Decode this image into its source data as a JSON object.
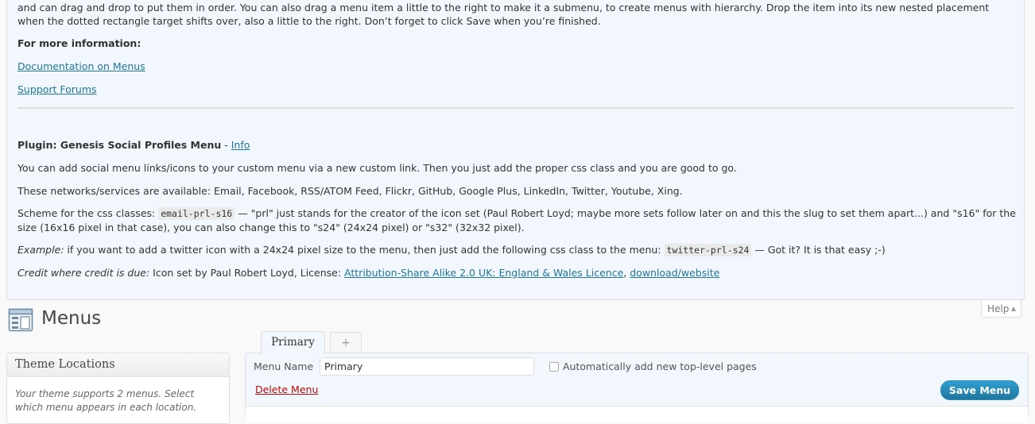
{
  "help": {
    "intro_text": "and can drag and drop to put them in order. You can also drag a menu item a little to the right to make it a submenu, to create menus with hierarchy. Drop the item into its new nested placement when the dotted rectangle target shifts over, also a little to the right. Don’t forget to click Save when you’re finished.",
    "more_info_title": "For more information:",
    "documentation_link": "Documentation on Menus",
    "support_link": "Support Forums",
    "plugin_title": "Plugin: Genesis Social Profiles Menu",
    "plugin_separator": " - ",
    "plugin_info_link": "Info",
    "add_text": "You can add social menu links/icons to your custom menu via a new custom link. Then you just add the proper css class and you are good to go.",
    "networks_text": "These networks/services are available: Email, Facebook, RSS/ATOM Feed, Flickr, GitHub, Google Plus, LinkedIn, Twitter, Youtube, Xing.",
    "scheme_prefix": "Scheme for the css classes: ",
    "scheme_code": "email-prl-s16",
    "scheme_text": " — \"prl\" just stands for the creator of the icon set (Paul Robert Loyd; maybe more sets follow later on and this the slug to set them apart...) and \"s16\" for the size (16x16 pixel in that case), you can also change this to \"s24\" (24x24 pixel) or \"s32\" (32x32 pixel).",
    "example_label": "Example:",
    "example_text": " if you want to add a twitter icon with a 24x24 pixel size to the menu, then just add the following css class to the menu: ",
    "example_code": "twitter-prl-s24",
    "example_suffix": " — Got it? It is that easy ;-)",
    "credit_label": "Credit where credit is due:",
    "credit_text": " Icon set by Paul Robert Loyd, License: ",
    "license_link": "Attribution-Share Alike 2.0 UK: England & Wales Licence",
    "credit_comma": ", ",
    "download_link": "download/website"
  },
  "help_tab": {
    "label": "Help",
    "arrow": "▲"
  },
  "page": {
    "title": "Menus",
    "icon": "menus-icon"
  },
  "theme_locations": {
    "title": "Theme Locations",
    "description": "Your theme supports 2 menus. Select which menu appears in each location."
  },
  "menu_tabs": {
    "active_label": "Primary",
    "add_label": "+"
  },
  "menu_edit": {
    "name_label": "Menu Name",
    "name_value": "Primary",
    "auto_add_label": "Automatically add new top-level pages",
    "auto_add_checked": false,
    "delete_label": "Delete Menu",
    "save_label": "Save Menu"
  },
  "colors": {
    "link": "#21759b",
    "delete": "#bc0b0b",
    "help_bg": "#f1f7fc",
    "primary_button": "#21759b"
  }
}
